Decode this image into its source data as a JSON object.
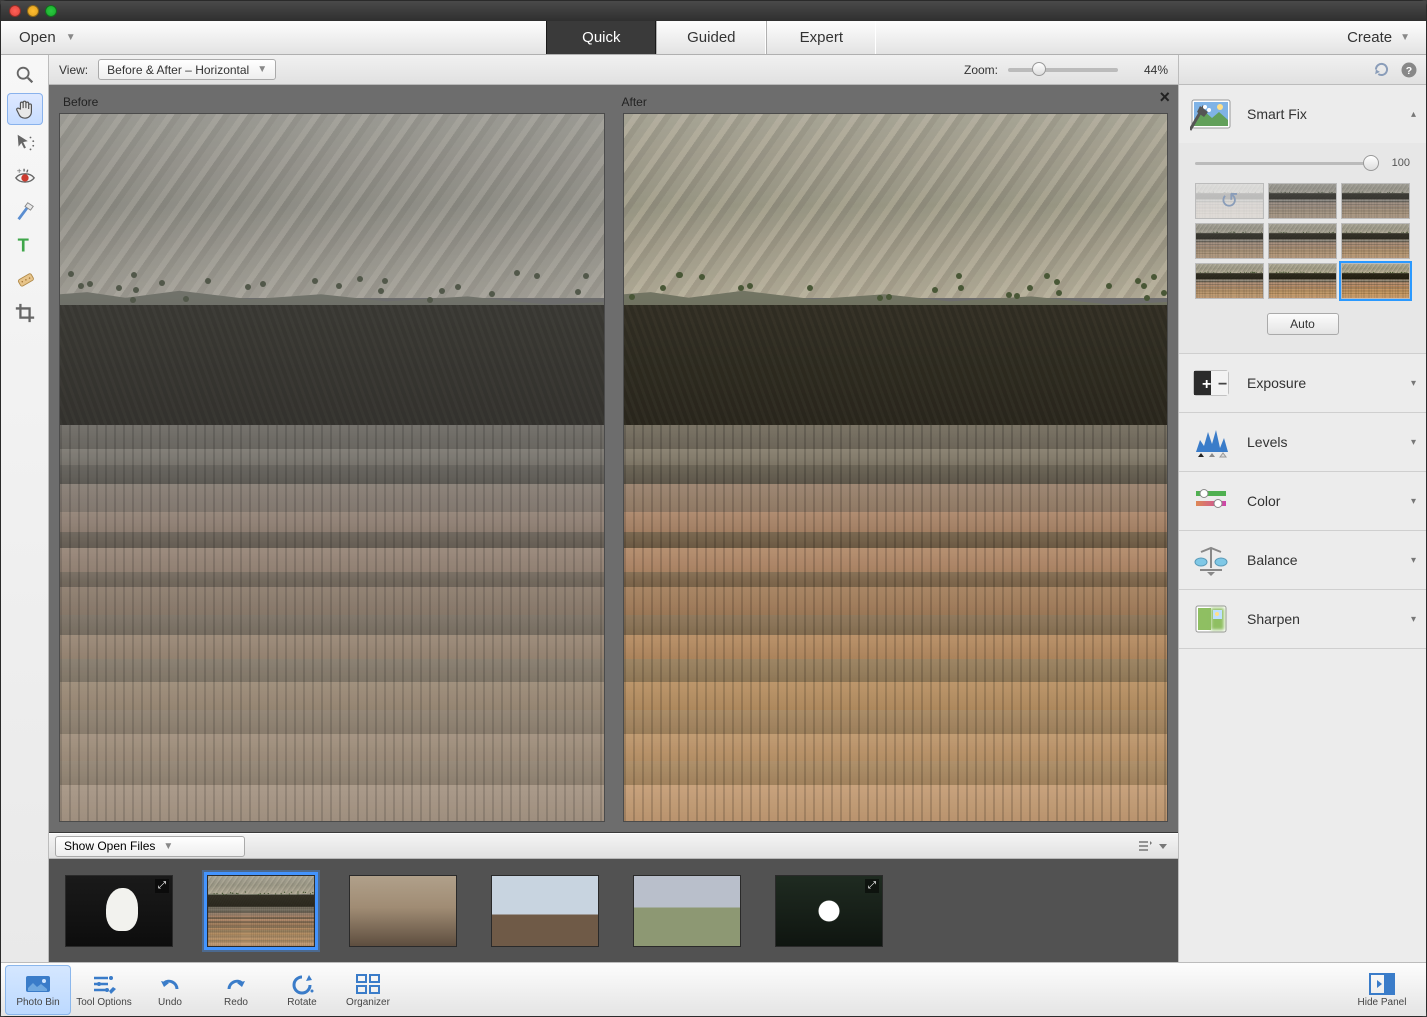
{
  "menubar": {
    "open": "Open",
    "create": "Create",
    "tabs": [
      {
        "label": "Quick",
        "active": true
      },
      {
        "label": "Guided",
        "active": false
      },
      {
        "label": "Expert",
        "active": false
      }
    ]
  },
  "optionsbar": {
    "view_label": "View:",
    "view_value": "Before & After – Horizontal",
    "zoom_label": "Zoom:",
    "zoom_value": "44%",
    "zoom_pct": 44
  },
  "canvas": {
    "before_label": "Before",
    "after_label": "After"
  },
  "photobin": {
    "dropdown": "Show Open Files",
    "thumbs": [
      {
        "kind": "bird",
        "selected": false,
        "ext": true
      },
      {
        "kind": "cliff",
        "selected": true,
        "ext": false
      },
      {
        "kind": "dusty",
        "selected": false,
        "ext": false
      },
      {
        "kind": "mesa",
        "selected": false,
        "ext": false
      },
      {
        "kind": "field",
        "selected": false,
        "ext": false
      },
      {
        "kind": "bird2",
        "selected": false,
        "ext": true
      }
    ]
  },
  "rightpanel": {
    "smartfix": {
      "title": "Smart Fix",
      "slider_value": "100",
      "auto_label": "Auto"
    },
    "sections": [
      {
        "id": "exposure",
        "title": "Exposure"
      },
      {
        "id": "levels",
        "title": "Levels"
      },
      {
        "id": "color",
        "title": "Color"
      },
      {
        "id": "balance",
        "title": "Balance"
      },
      {
        "id": "sharpen",
        "title": "Sharpen"
      }
    ]
  },
  "bottombar": {
    "items": [
      {
        "id": "photobin",
        "label": "Photo Bin",
        "active": true
      },
      {
        "id": "tooloptions",
        "label": "Tool Options",
        "active": false
      },
      {
        "id": "undo",
        "label": "Undo",
        "active": false
      },
      {
        "id": "redo",
        "label": "Redo",
        "active": false
      },
      {
        "id": "rotate",
        "label": "Rotate",
        "active": false
      },
      {
        "id": "organizer",
        "label": "Organizer",
        "active": false
      }
    ],
    "hide_panel": "Hide Panel"
  },
  "tools": [
    {
      "id": "zoom",
      "active": false
    },
    {
      "id": "hand",
      "active": true
    },
    {
      "id": "quicksel",
      "active": false
    },
    {
      "id": "redeye",
      "active": false
    },
    {
      "id": "whiten",
      "active": false
    },
    {
      "id": "text",
      "active": false
    },
    {
      "id": "heal",
      "active": false
    },
    {
      "id": "crop",
      "active": false
    }
  ],
  "strata_bands": [
    {
      "h": 6,
      "c": "#7b7569"
    },
    {
      "h": 4,
      "c": "#8b8476"
    },
    {
      "h": 5,
      "c": "#6e685c"
    },
    {
      "h": 7,
      "c": "#9b8775"
    },
    {
      "h": 5,
      "c": "#ab8c74"
    },
    {
      "h": 4,
      "c": "#7a6a56"
    },
    {
      "h": 6,
      "c": "#b18f74"
    },
    {
      "h": 4,
      "c": "#86725b"
    },
    {
      "h": 7,
      "c": "#a58669"
    },
    {
      "h": 5,
      "c": "#8f7b62"
    },
    {
      "h": 6,
      "c": "#b4916e"
    },
    {
      "h": 6,
      "c": "#9a8568"
    },
    {
      "h": 7,
      "c": "#b6956f"
    },
    {
      "h": 6,
      "c": "#a68c6c"
    },
    {
      "h": 7,
      "c": "#bb9a76"
    },
    {
      "h": 6,
      "c": "#aa8f6e"
    },
    {
      "h": 9,
      "c": "#c1a07f"
    }
  ]
}
